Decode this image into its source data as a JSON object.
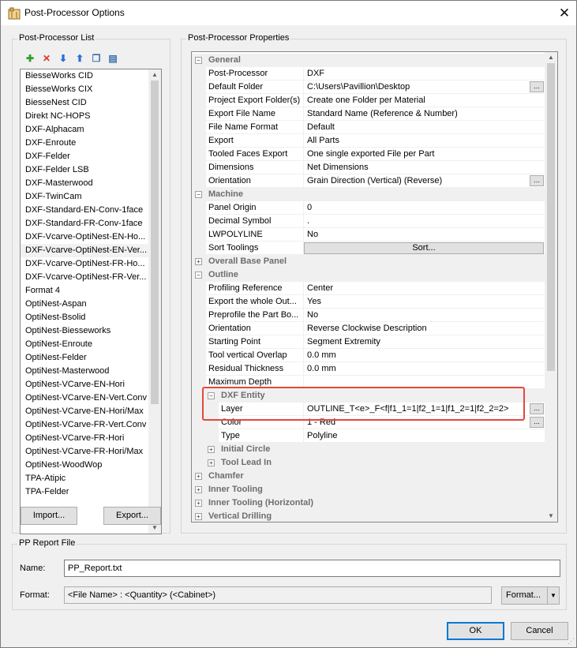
{
  "window": {
    "title": "Post-Processor Options",
    "close_glyph": "✕"
  },
  "list_panel": {
    "title": "Post-Processor List",
    "toolbar": [
      {
        "icon": "add-icon",
        "glyph": "✚",
        "color": "#2e9d2e"
      },
      {
        "icon": "delete-icon",
        "glyph": "✕",
        "color": "#d9342b"
      },
      {
        "icon": "move-down-icon",
        "glyph": "⬇",
        "color": "#2b6fd6"
      },
      {
        "icon": "move-up-icon",
        "glyph": "⬆",
        "color": "#2b6fd6"
      },
      {
        "icon": "copy-icon",
        "glyph": "❐",
        "color": "#3a6fb0"
      },
      {
        "icon": "properties-icon",
        "glyph": "▤",
        "color": "#3a6fb0"
      }
    ],
    "items": [
      "BiesseWorks CID",
      "BiesseWorks CIX",
      "BiesseNest CID",
      "Direkt NC-HOPS",
      "DXF-Alphacam",
      "DXF-Enroute",
      "DXF-Felder",
      "DXF-Felder LSB",
      "DXF-Masterwood",
      "DXF-TwinCam",
      "DXF-Standard-EN-Conv-1face",
      "DXF-Standard-FR-Conv-1face",
      "DXF-Vcarve-OptiNest-EN-Ho...",
      "DXF-Vcarve-OptiNest-EN-Ver...",
      "DXF-Vcarve-OptiNest-FR-Ho...",
      "DXF-Vcarve-OptiNest-FR-Ver...",
      "Format 4",
      "OptiNest-Aspan",
      "OptiNest-Bsolid",
      "OptiNest-Biesseworks",
      "OptiNest-Enroute",
      "OptiNest-Felder",
      "OptiNest-Masterwood",
      "OptiNest-VCarve-EN-Hori",
      "OptiNest-VCarve-EN-Vert.Conv",
      "OptiNest-VCarve-EN-Hori/Max",
      "OptiNest-VCarve-FR-Vert.Conv",
      "OptiNest-VCarve-FR-Hori",
      "OptiNest-VCarve-FR-Hori/Max",
      "OptiNest-WoodWop",
      "TPA-Atipic",
      "TPA-Felder"
    ],
    "selected_index": 13,
    "import_label": "Import...",
    "export_label": "Export..."
  },
  "props_panel": {
    "title": "Post-Processor Properties",
    "rows": [
      {
        "type": "cat",
        "label": "General",
        "expanded": true,
        "level": 0
      },
      {
        "type": "prop",
        "name": "Post-Processor",
        "value": "DXF"
      },
      {
        "type": "prop",
        "name": "Default Folder",
        "value": "C:\\Users\\Pavillion\\Desktop",
        "ellipsis": true
      },
      {
        "type": "prop",
        "name": "Project Export Folder(s)",
        "value": "Create one Folder per Material"
      },
      {
        "type": "prop",
        "name": "Export File Name",
        "value": "Standard Name (Reference & Number)"
      },
      {
        "type": "prop",
        "name": "File Name Format",
        "value": "Default"
      },
      {
        "type": "prop",
        "name": "Export",
        "value": "All Parts"
      },
      {
        "type": "prop",
        "name": "Tooled Faces Export",
        "value": "One single exported File per Part"
      },
      {
        "type": "prop",
        "name": "Dimensions",
        "value": "Net Dimensions"
      },
      {
        "type": "prop",
        "name": "Orientation",
        "value": "Grain Direction (Vertical) (Reverse)",
        "ellipsis": true
      },
      {
        "type": "cat",
        "label": "Machine",
        "expanded": true,
        "level": 0
      },
      {
        "type": "prop",
        "name": "Panel Origin",
        "value": "0"
      },
      {
        "type": "prop",
        "name": "Decimal Symbol",
        "value": "."
      },
      {
        "type": "prop",
        "name": "LWPOLYLINE",
        "value": "No"
      },
      {
        "type": "prop",
        "name": "Sort Toolings",
        "value": "Sort...",
        "button": true
      },
      {
        "type": "cat",
        "label": "Overall Base Panel",
        "expanded": false,
        "level": 0
      },
      {
        "type": "cat",
        "label": "Outline",
        "expanded": true,
        "level": 0
      },
      {
        "type": "prop",
        "name": "Profiling Reference",
        "value": "Center"
      },
      {
        "type": "prop",
        "name": "Export the whole Out...",
        "value": "Yes"
      },
      {
        "type": "prop",
        "name": "Preprofile the Part Bo...",
        "value": "No"
      },
      {
        "type": "prop",
        "name": "Orientation",
        "value": "Reverse Clockwise Description"
      },
      {
        "type": "prop",
        "name": "Starting Point",
        "value": "Segment Extremity"
      },
      {
        "type": "prop",
        "name": "Tool vertical Overlap",
        "value": "0.0 mm"
      },
      {
        "type": "prop",
        "name": "Residual Thickness",
        "value": "0.0 mm"
      },
      {
        "type": "prop",
        "name": "Maximum Depth",
        "value": ""
      },
      {
        "type": "cat",
        "label": "DXF Entity",
        "expanded": true,
        "level": 1
      },
      {
        "type": "prop",
        "name": "Layer",
        "value": "OUTLINE_T<e>_F<f|f1_1=1|f2_1=1|f1_2=1|f2_2=2>",
        "ellipsis": true,
        "level": 1
      },
      {
        "type": "prop",
        "name": "Color",
        "value": "1 - Red",
        "ellipsis": true,
        "level": 1
      },
      {
        "type": "prop",
        "name": "Type",
        "value": "Polyline",
        "level": 1
      },
      {
        "type": "cat",
        "label": "Initial Circle",
        "expanded": false,
        "level": 1
      },
      {
        "type": "cat",
        "label": "Tool Lead In",
        "expanded": false,
        "level": 1
      },
      {
        "type": "cat",
        "label": "Chamfer",
        "expanded": false,
        "level": 0
      },
      {
        "type": "cat",
        "label": "Inner Tooling",
        "expanded": false,
        "level": 0
      },
      {
        "type": "cat",
        "label": "Inner Tooling (Horizontal)",
        "expanded": false,
        "level": 0
      },
      {
        "type": "cat",
        "label": "Vertical Drilling",
        "expanded": false,
        "level": 0
      }
    ]
  },
  "report": {
    "title": "PP Report File",
    "name_label": "Name:",
    "name_value": "PP_Report.txt",
    "format_label": "Format:",
    "format_value": "<File Name> : <Quantity> (<Cabinet>)",
    "format_button": "Format...",
    "format_arrow": "▼"
  },
  "footer": {
    "ok_label": "OK",
    "cancel_label": "Cancel"
  },
  "colors": {
    "highlight": "#e8463c",
    "accent": "#0078d7"
  }
}
